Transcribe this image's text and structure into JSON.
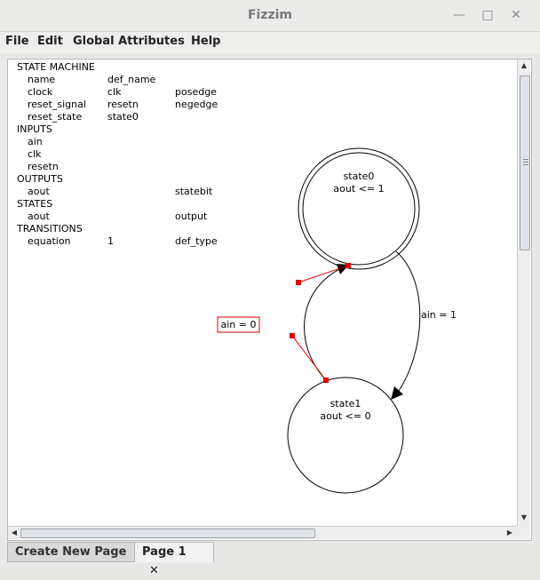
{
  "window": {
    "title": "Fizzim",
    "minimize_icon": "minimize-icon",
    "maximize_icon": "maximize-icon",
    "close_icon": "close-icon"
  },
  "menubar": {
    "file": "File",
    "edit": "Edit",
    "global_attributes": "Global Attributes",
    "help": "Help"
  },
  "attributes": {
    "state_machine_header": "STATE MACHINE",
    "sm_rows": [
      {
        "name": "name",
        "value": "def_name",
        "extra": ""
      },
      {
        "name": "clock",
        "value": "clk",
        "extra": "posedge"
      },
      {
        "name": "reset_signal",
        "value": "resetn",
        "extra": "negedge"
      },
      {
        "name": "reset_state",
        "value": "state0",
        "extra": ""
      }
    ],
    "inputs_header": "INPUTS",
    "inputs": [
      "ain",
      "clk",
      "resetn"
    ],
    "outputs_header": "OUTPUTS",
    "outputs": [
      {
        "name": "aout",
        "extra": "statebit"
      }
    ],
    "states_header": "STATES",
    "states": [
      {
        "name": "aout",
        "extra": "output"
      }
    ],
    "transitions_header": "TRANSITIONS",
    "transitions": [
      {
        "name": "equation",
        "value": "1",
        "extra": "def_type"
      }
    ]
  },
  "diagram": {
    "state0": {
      "name": "state0",
      "output": "aout <= 1"
    },
    "state1": {
      "name": "state1",
      "output": "aout <= 0"
    },
    "transition_0_to_1": "ain = 1",
    "transition_1_to_0": "ain = 0"
  },
  "tabs": {
    "create_new_page": "Create New Page",
    "page1": "Page 1",
    "close_glyph": "✕"
  },
  "colors": {
    "transition_red": "#e00000",
    "handle_red": "#e00000"
  }
}
